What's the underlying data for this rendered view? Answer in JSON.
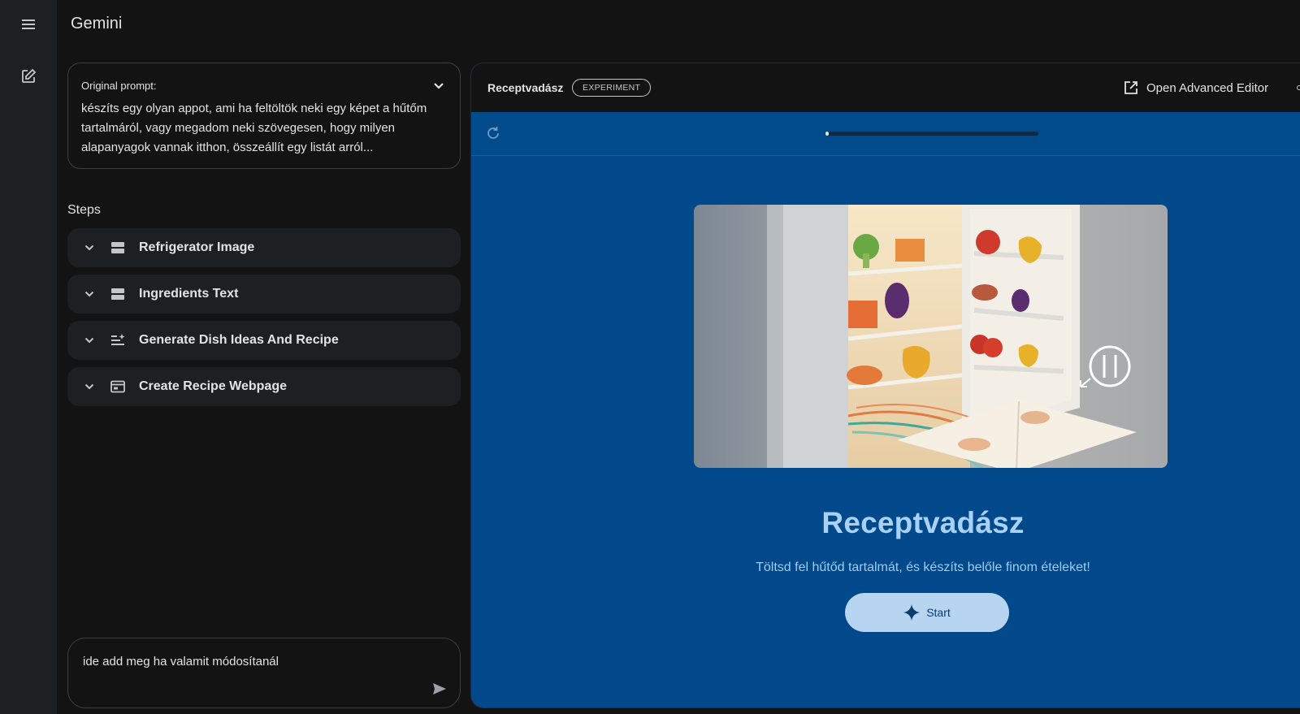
{
  "app": {
    "title": "Gemini"
  },
  "left_panel": {
    "prompt": {
      "label": "Original prompt:",
      "text": "készíts egy olyan appot, ami ha feltöltök neki egy képet a hűtőm tartalmáról, vagy megadom neki szövegesen, hogy milyen alapanyagok vannak itthon, összeállít egy listát arról..."
    },
    "steps_heading": "Steps",
    "steps": [
      {
        "label": "Refrigerator Image",
        "icon": "input-icon"
      },
      {
        "label": "Ingredients Text",
        "icon": "input-icon"
      },
      {
        "label": "Generate Dish Ideas And Recipe",
        "icon": "sparkle-list-icon"
      },
      {
        "label": "Create Recipe Webpage",
        "icon": "web-icon"
      }
    ],
    "input": {
      "placeholder": "ide add meg ha valamit módosítanál"
    }
  },
  "preview": {
    "app_name": "Receptvadász",
    "badge": "EXPERIMENT",
    "open_editor_label": "Open Advanced Editor",
    "progress": 0.01,
    "hero_title": "Receptvadász",
    "hero_subtitle": "Töltsd fel hűtőd tartalmát, és készíts belőle finom ételeket!",
    "start_label": "Start"
  },
  "colors": {
    "background": "#131314",
    "rail": "#1e1f20",
    "preview_bg": "#01498a",
    "hero_title": "#a8d1f5",
    "start_button": "#b7d4f1"
  }
}
